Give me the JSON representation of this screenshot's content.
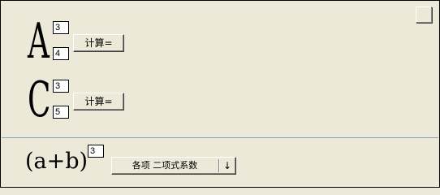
{
  "arrangement": {
    "letter": "A",
    "top_value": "3",
    "bottom_value": "4",
    "button_label": "计算="
  },
  "combination": {
    "letter": "C",
    "top_value": "3",
    "bottom_value": "5",
    "button_label": "计算="
  },
  "binomial": {
    "expression": "(a+b)",
    "exponent_value": "3",
    "mode_selected": "各项  二项式系数",
    "dropdown_arrow": "↓"
  },
  "colors": {
    "background": "#ece9d8",
    "divider": "#8a9bd3"
  }
}
